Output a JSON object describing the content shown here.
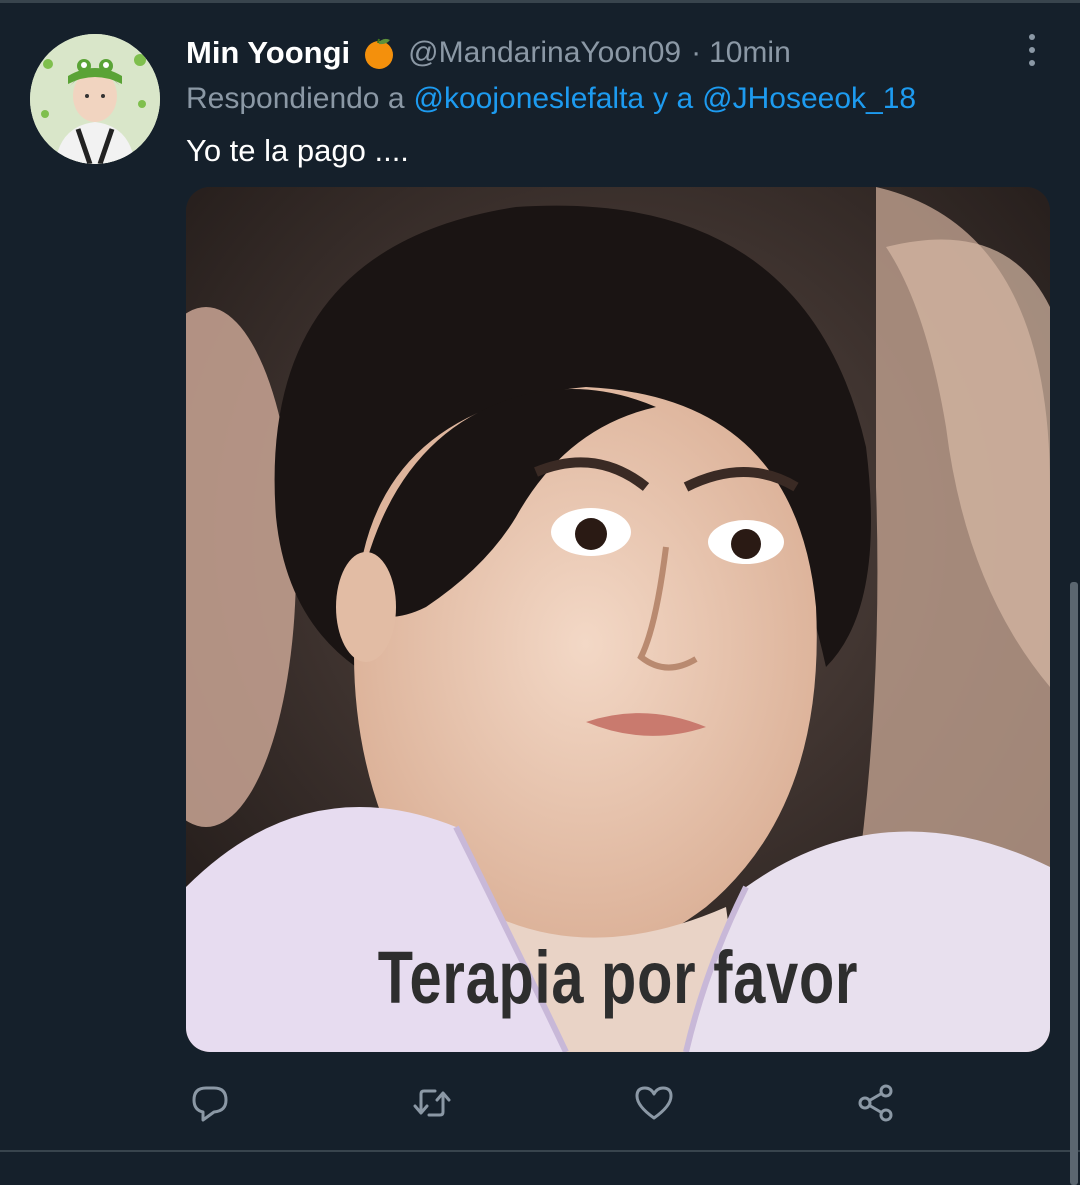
{
  "tweet": {
    "author": {
      "display_name": "Min Yoongi",
      "badge_emoji": "orange-emoji",
      "handle": "@MandarinaYoon09",
      "separator": "·",
      "timestamp": "10min"
    },
    "reply_context": {
      "prefix": "Respondiendo a",
      "mention_1": "@koojoneslefalta",
      "conjunction": "y a",
      "mention_2": "@JHoseeok_18"
    },
    "text": "Yo te la pago ....",
    "media": {
      "caption": "Terapia por favor"
    },
    "actions": [
      "reply-icon",
      "retweet-icon",
      "like-icon",
      "share-icon"
    ]
  },
  "colors": {
    "background": "#15202b",
    "text_primary": "#ffffff",
    "text_secondary": "#8b98a5",
    "link": "#1d9bf0",
    "divider": "#38444d"
  }
}
